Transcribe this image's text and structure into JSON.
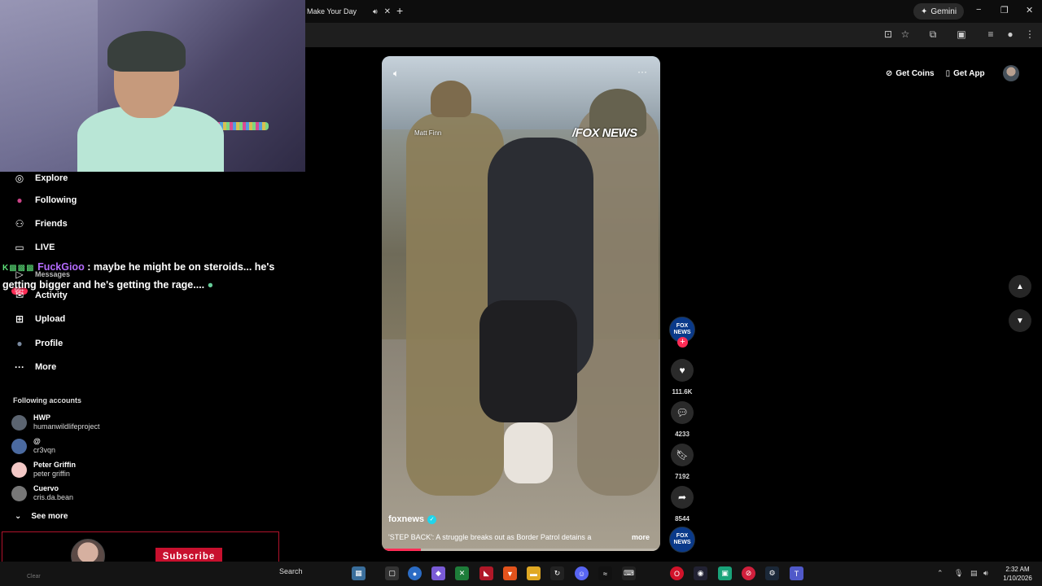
{
  "browser": {
    "tab_title": "Make Your Day",
    "new_tab_icon": "+",
    "gemini_label": "Gemini",
    "window_controls": {
      "minimize": "−",
      "restore": "❐",
      "close": "✕"
    }
  },
  "sidebar": {
    "items": [
      {
        "label": "Explore",
        "icon": "compass-icon",
        "glyph": "◎"
      },
      {
        "label": "Following",
        "icon": "following-avatar-icon",
        "glyph": "●"
      },
      {
        "label": "Friends",
        "icon": "friends-icon",
        "glyph": "⚇"
      },
      {
        "label": "LIVE",
        "icon": "live-icon",
        "glyph": "▭"
      },
      {
        "label": "Activity",
        "icon": "activity-icon",
        "glyph": "✉"
      },
      {
        "label": "Upload",
        "icon": "upload-icon",
        "glyph": "⊞"
      },
      {
        "label": "Profile",
        "icon": "profile-avatar-icon",
        "glyph": "●"
      },
      {
        "label": "More",
        "icon": "more-icon",
        "glyph": "···"
      }
    ],
    "activity_badge": "99+",
    "messages_label": "Messages",
    "following_accounts_title": "Following accounts",
    "following_accounts": [
      {
        "name": "HWP",
        "handle": "humanwildlifeproject",
        "color": "#5b6470"
      },
      {
        "name": "@",
        "handle": "cr3vqn",
        "color": "#4b6aa0"
      },
      {
        "name": "Peter Griffin",
        "handle": "peter griffin",
        "color": "#f3c8c6"
      },
      {
        "name": "Cuervo",
        "handle": "cris.da.bean",
        "color": "#777777"
      }
    ],
    "see_more_label": "See more"
  },
  "chat": {
    "emotes": "K▩▩▩",
    "username": "FuckGioo",
    "message": ": maybe he might be on steroids... he's getting bigger and he's getting the rage...."
  },
  "stream_widget": {
    "subscribe_label": "Subscribe"
  },
  "video": {
    "watermark": "/FOX NEWS",
    "reporter_tag": "Matt Finn",
    "author": "foxnews",
    "caption": "'STEP BACK': A struggle breaks out as Border Patrol detains a",
    "more_label": "more",
    "menu_glyph": "···",
    "progress_fraction": 0.14
  },
  "actions": {
    "channel_avatar_text": "FOX NEWS",
    "likes": "111.6K",
    "comments": "4233",
    "saves": "7192",
    "shares": "8544"
  },
  "top_right": {
    "get_coins": "Get Coins",
    "get_app": "Get App"
  },
  "taskbar": {
    "search_label": "Search",
    "under_label": "Clear",
    "time": "2:32 AM",
    "date": "1/10/2026"
  }
}
